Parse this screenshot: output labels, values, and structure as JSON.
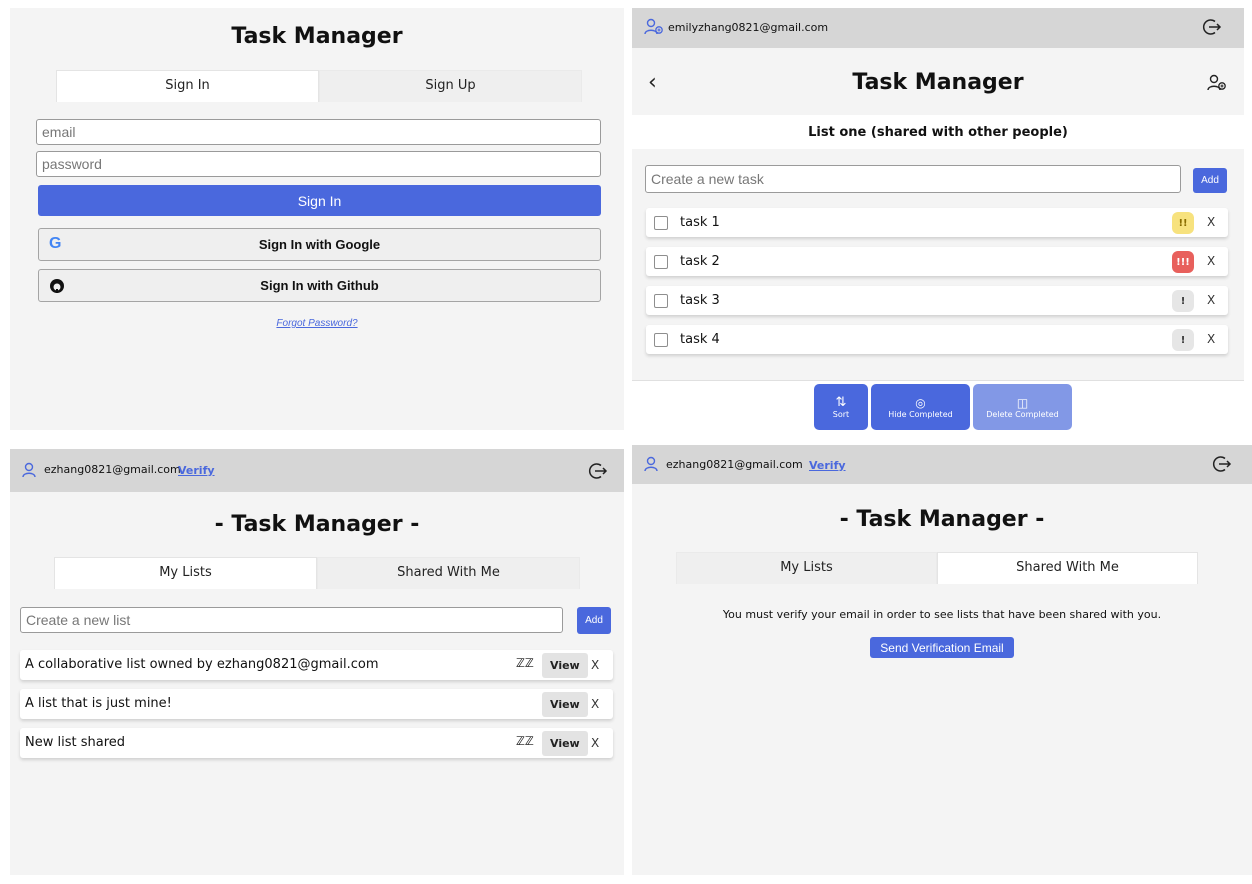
{
  "app_title": "Task Manager",
  "app_title_decorated": "- Task Manager -",
  "signin": {
    "tab_signin": "Sign In",
    "tab_signup": "Sign Up",
    "email_placeholder": "email",
    "password_placeholder": "password",
    "signin_button": "Sign In",
    "google_button": "Sign In with Google",
    "github_button": "Sign In with Github",
    "forgot_link": "Forgot Password?"
  },
  "list_view": {
    "user_email": "emilyzhang0821@gmail.com",
    "list_title": "List one (shared with other people)",
    "new_task_placeholder": "Create a new task",
    "add_label": "Add",
    "tasks": [
      {
        "name": "task 1",
        "priority": "!!",
        "color": "#f7e27e"
      },
      {
        "name": "task 2",
        "priority": "!!!",
        "color": "#e8605c"
      },
      {
        "name": "task 3",
        "priority": "!",
        "color": "#e6e6e6"
      },
      {
        "name": "task 4",
        "priority": "!",
        "color": "#e6e6e6"
      }
    ],
    "delete_x": "X",
    "toolbar": {
      "sort": "Sort",
      "hide": "Hide Completed",
      "delete": "Delete Completed"
    }
  },
  "my_lists": {
    "user_email": "ezhang0821@gmail.com",
    "verify_label": "Verify",
    "tab_my": "My Lists",
    "tab_shared": "Shared With Me",
    "new_list_placeholder": "Create a new list",
    "add_label": "Add",
    "view_label": "View",
    "delete_x": "X",
    "lists": [
      {
        "name": "A collaborative list owned by ezhang0821@gmail.com",
        "shared": true
      },
      {
        "name": "A list that is just mine!",
        "shared": false
      },
      {
        "name": "New list shared",
        "shared": true
      }
    ]
  },
  "shared_view": {
    "user_email": "ezhang0821@gmail.com",
    "verify_label": "Verify",
    "tab_my": "My Lists",
    "tab_shared": "Shared With Me",
    "message": "You must verify your email in order to see lists that have been shared with you.",
    "send_button": "Send Verification Email"
  },
  "colors": {
    "accent": "#4a68dd",
    "header_bg": "#d6d6d6",
    "panel_bg": "#f4f4f4"
  }
}
